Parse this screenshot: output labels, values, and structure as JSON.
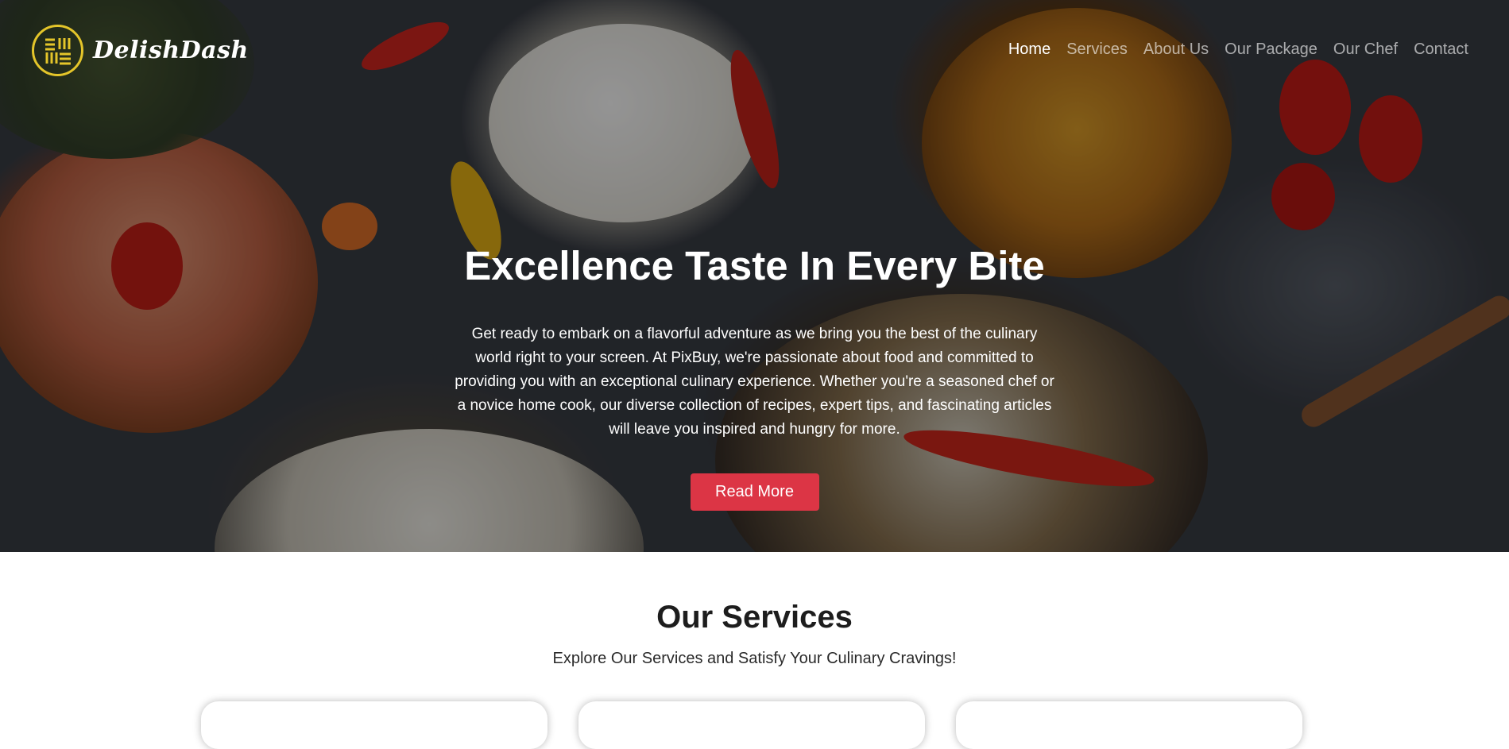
{
  "brand": {
    "name": "DelishDash",
    "accent": "#e4c52a"
  },
  "nav": {
    "items": [
      {
        "label": "Home",
        "active": true
      },
      {
        "label": "Services",
        "active": false
      },
      {
        "label": "About Us",
        "active": false
      },
      {
        "label": "Our Package",
        "active": false
      },
      {
        "label": "Our Chef",
        "active": false
      },
      {
        "label": "Contact",
        "active": false
      }
    ]
  },
  "hero": {
    "title": "Excellence Taste In Every Bite",
    "text": "Get ready to embark on a flavorful adventure as we bring you the best of the culinary world right to your screen. At PixBuy, we're passionate about food and committed to providing you with an exceptional culinary experience. Whether you're a seasoned chef or a novice home cook, our diverse collection of recipes, expert tips, and fascinating articles will leave you inspired and hungry for more.",
    "button_label": "Read More",
    "button_color": "#dc3545"
  },
  "services": {
    "title": "Our Services",
    "subtitle": "Explore Our Services and Satisfy Your Culinary Cravings!"
  }
}
